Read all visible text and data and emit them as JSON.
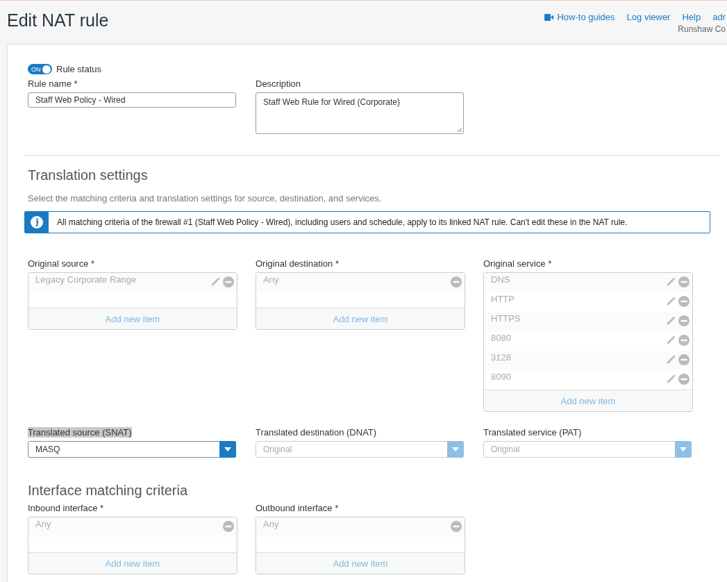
{
  "header": {
    "title": "Edit NAT rule",
    "links": [
      {
        "label": "How-to guides",
        "kind": "video"
      },
      {
        "label": "Log viewer",
        "kind": "plain"
      },
      {
        "label": "Help",
        "kind": "plain"
      },
      {
        "label": "adr",
        "kind": "plain"
      }
    ],
    "subtitle": "Runshaw Co"
  },
  "rule_status": {
    "toggle_text": "ON",
    "on": true,
    "label": "Rule status"
  },
  "rule_name": {
    "label": "Rule name *",
    "value": "Staff Web Policy - Wired"
  },
  "description": {
    "label": "Description",
    "value": "Staff Web Rule for Wired (Corporate)"
  },
  "translation": {
    "heading": "Translation settings",
    "subtitle": "Select the matching criteria and translation settings for source, destination, and services.",
    "info": "All matching criteria of the firewall #1 (Staff Web Policy - Wired), including users and schedule, apply to its linked NAT rule. Can't edit these in the NAT rule.",
    "lists": [
      {
        "label": "Original source *",
        "items": [
          {
            "text": "Legacy Corporate Range",
            "editable": true
          }
        ],
        "add": "Add new item"
      },
      {
        "label": "Original destination *",
        "items": [
          {
            "text": "Any",
            "editable": false
          }
        ],
        "add": "Add new item"
      },
      {
        "label": "Original service *",
        "items": [
          {
            "text": "DNS",
            "editable": true
          },
          {
            "text": "HTTP",
            "editable": true
          },
          {
            "text": "HTTPS",
            "editable": true
          },
          {
            "text": "8080",
            "editable": true
          },
          {
            "text": "3128",
            "editable": true
          },
          {
            "text": "8090",
            "editable": true
          }
        ],
        "add": "Add new item"
      }
    ],
    "dropdowns": [
      {
        "label": "Translated source (SNAT)",
        "highlighted": true,
        "value": "MASQ",
        "disabled": false
      },
      {
        "label": "Translated destination (DNAT)",
        "highlighted": false,
        "value": "Original",
        "disabled": true
      },
      {
        "label": "Translated service (PAT)",
        "highlighted": false,
        "value": "Original",
        "disabled": true
      }
    ]
  },
  "interface": {
    "heading": "Interface matching criteria",
    "lists": [
      {
        "label": "Inbound interface *",
        "items": [
          {
            "text": "Any",
            "editable": false
          }
        ],
        "add": "Add new item"
      },
      {
        "label": "Outbound interface *",
        "items": [
          {
            "text": "Any",
            "editable": false
          }
        ],
        "add": "Add new item"
      }
    ]
  }
}
